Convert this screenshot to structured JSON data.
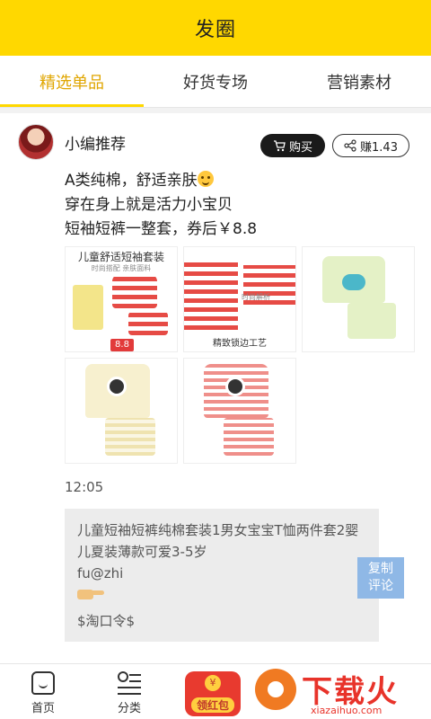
{
  "header": {
    "title": "发圈"
  },
  "tabs": [
    {
      "label": "精选单品",
      "active": true
    },
    {
      "label": "好货专场",
      "active": false
    },
    {
      "label": "营销素材",
      "active": false
    }
  ],
  "post": {
    "author": "小编推荐",
    "buy_label": "购买",
    "earn_label": "赚1.43",
    "lines": [
      "A类纯棉，舒适亲肤",
      "穿在身上就是活力小宝贝",
      "短袖短裤一整套，券后￥8.8"
    ],
    "images": [
      {
        "caption": "儿童舒适短袖套装",
        "sub": "时尚搭配 亲肤面料",
        "price_tag": "8.8"
      },
      {
        "caption": "精致锁边工艺",
        "sub": "时尚解析"
      },
      {
        "caption": ""
      },
      {
        "caption": ""
      },
      {
        "caption": ""
      }
    ],
    "time": "12:05",
    "copy_text": "儿童短袖短裤纯棉套装1男女宝宝T恤两件套2婴儿夏装薄款可爱3-5岁",
    "copy_user": "fu@zhi",
    "copy_code": "$淘口令$",
    "copy_button": "复制评论"
  },
  "bottom_nav": {
    "home": "首页",
    "category": "分类",
    "red_packet": "领红包"
  },
  "watermark": {
    "text": "下载火",
    "url": "xiazaihuo.com"
  },
  "colors": {
    "accent": "#FFD800",
    "active_tab": "#E0A600",
    "copy_button": "#8fb8e6"
  }
}
